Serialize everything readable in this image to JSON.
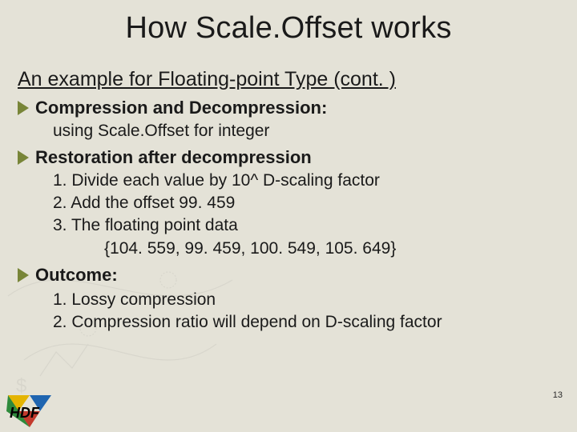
{
  "title": "How Scale.Offset works",
  "subtitle": "An example for Floating-point Type (cont. )",
  "bullets": [
    {
      "head": "Compression and Decompression",
      "colon": ":",
      "subs": [
        "using Scale.Offset for integer"
      ]
    },
    {
      "head": "Restoration after decompression",
      "colon": "",
      "subs": [
        "1. Divide each value by 10^ D-scaling factor",
        "2. Add the offset 99. 459",
        "3. The floating point data"
      ],
      "indent2": [
        "{104. 559, 99. 459, 100. 549, 105. 649}"
      ]
    },
    {
      "head": "Outcome",
      "colon": ":",
      "subs": [
        "1. Lossy compression",
        "2. Compression ratio will depend on D-scaling factor"
      ]
    }
  ],
  "page_number": "13",
  "logo_text": "HDF"
}
